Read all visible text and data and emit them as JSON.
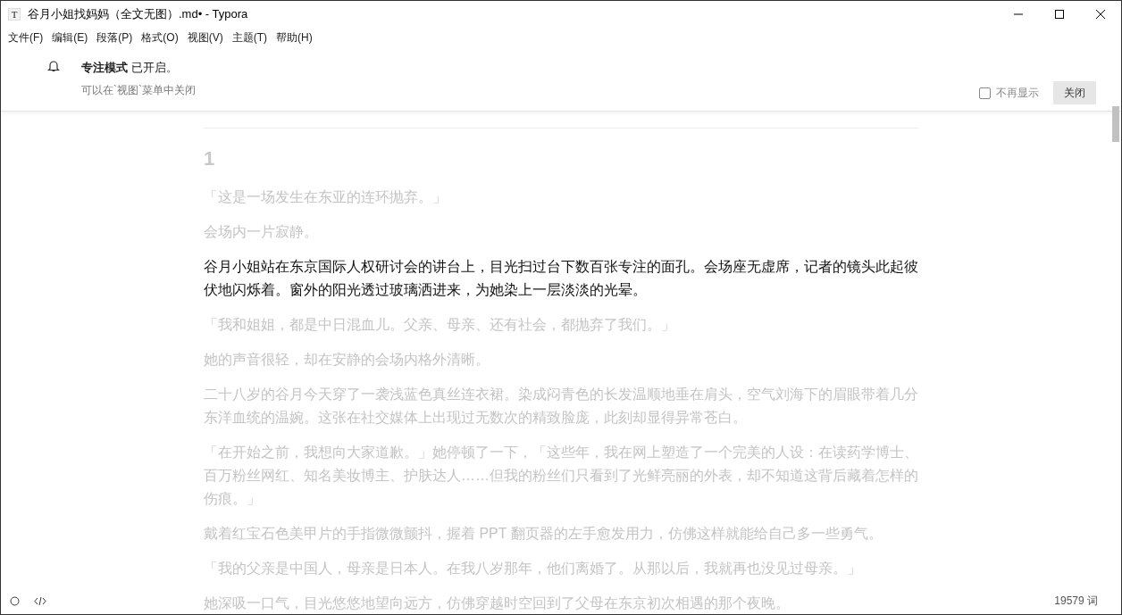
{
  "window": {
    "title": "谷月小姐找妈妈（全文无图）.md• - Typora",
    "app_icon": "T"
  },
  "menu": [
    "文件(F)",
    "编辑(E)",
    "段落(P)",
    "格式(O)",
    "视图(V)",
    "主题(T)",
    "帮助(H)"
  ],
  "notification": {
    "title_bold": "专注模式",
    "title_rest": "已开启。",
    "hint": "可以在`视图`菜单中关闭",
    "checkbox": {
      "label": "不再显示",
      "checked": false
    },
    "button": "关闭"
  },
  "document": [
    {
      "kind": "h2",
      "text": "1",
      "focused": false
    },
    {
      "kind": "p",
      "text": "「这是一场发生在东亚的连环抛弃。」",
      "focused": false
    },
    {
      "kind": "p",
      "text": "会场内一片寂静。",
      "focused": false
    },
    {
      "kind": "p",
      "text": "谷月小姐站在东京国际人权研讨会的讲台上，目光扫过台下数百张专注的面孔。会场座无虚席，记者的镜头此起彼伏地闪烁着。窗外的阳光透过玻璃洒进来，为她染上一层淡淡的光晕。",
      "focused": true
    },
    {
      "kind": "p",
      "text": "「我和姐姐，都是中日混血儿。父亲、母亲、还有社会，都抛弃了我们。」",
      "focused": false
    },
    {
      "kind": "p",
      "text": "她的声音很轻，却在安静的会场内格外清晰。",
      "focused": false
    },
    {
      "kind": "p",
      "text": "二十八岁的谷月今天穿了一袭浅蓝色真丝连衣裙。染成闷青色的长发温顺地垂在肩头，空气刘海下的眉眼带着几分东洋血统的温婉。这张在社交媒体上出现过无数次的精致脸庞，此刻却显得异常苍白。",
      "focused": false
    },
    {
      "kind": "p",
      "text": "「在开始之前，我想向大家道歉。」她停顿了一下，「这些年，我在网上塑造了一个完美的人设：在读药学博士、百万粉丝网红、知名美妆博主、护肤达人……但我的粉丝们只看到了光鲜亮丽的外表，却不知道这背后藏着怎样的伤痕。」",
      "focused": false
    },
    {
      "kind": "p",
      "text": "戴着红宝石色美甲片的手指微微颤抖，握着 PPT 翻页器的左手愈发用力，仿佛这样就能给自己多一些勇气。",
      "focused": false
    },
    {
      "kind": "p",
      "text": "「我的父亲是中国人，母亲是日本人。在我八岁那年，他们离婚了。从那以后，我就再也没见过母亲。」",
      "focused": false
    },
    {
      "kind": "p",
      "text": "她深吸一口气，目光悠悠地望向远方，仿佛穿越时空回到了父母在东京初次相遇的那个夜晚。",
      "focused": false
    }
  ],
  "status_bar": {
    "word_count": "19579 词"
  }
}
